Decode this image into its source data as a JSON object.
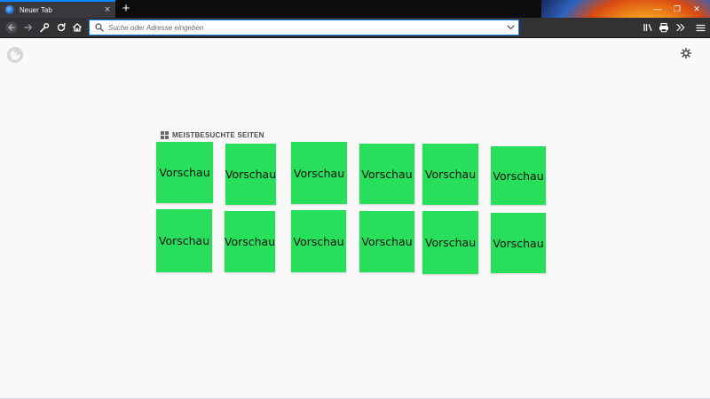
{
  "colors": {
    "tab_strip_bg": "#0c0c0d",
    "navbar_bg": "#323234",
    "active_tab_bg": "#38383d",
    "accent": "#0a84ff",
    "page_bg": "#f9f9fa",
    "tile_color": "#27df5a"
  },
  "tab": {
    "title": "Neuer Tab",
    "favicon_icon": "firefox-globe-icon",
    "close_label": "×"
  },
  "tabstrip": {
    "new_tab_label": "+"
  },
  "window_controls": {
    "minimize": "—",
    "maximize": "❐",
    "close": "✕"
  },
  "navbar": {
    "back_icon": "back-arrow-icon",
    "forward_icon": "forward-arrow-icon",
    "tools_icon": "wrench-icon",
    "reload_icon": "reload-icon",
    "home_icon": "home-icon",
    "library_icon": "library-icon",
    "print_icon": "print-icon",
    "overflow_icon": "overflow-chevrons-icon",
    "menu_icon": "hamburger-menu-icon"
  },
  "urlbar": {
    "placeholder": "Suche oder Adresse eingeben",
    "value": ""
  },
  "newtab": {
    "top_sites_title": "MEISTBESUCHTE SEITEN",
    "tiles": [
      "Vorschau",
      "Vorschau",
      "Vorschau",
      "Vorschau",
      "Vorschau",
      "Vorschau",
      "Vorschau",
      "Vorschau",
      "Vorschau",
      "Vorschau",
      "Vorschau",
      "Vorschau"
    ]
  }
}
